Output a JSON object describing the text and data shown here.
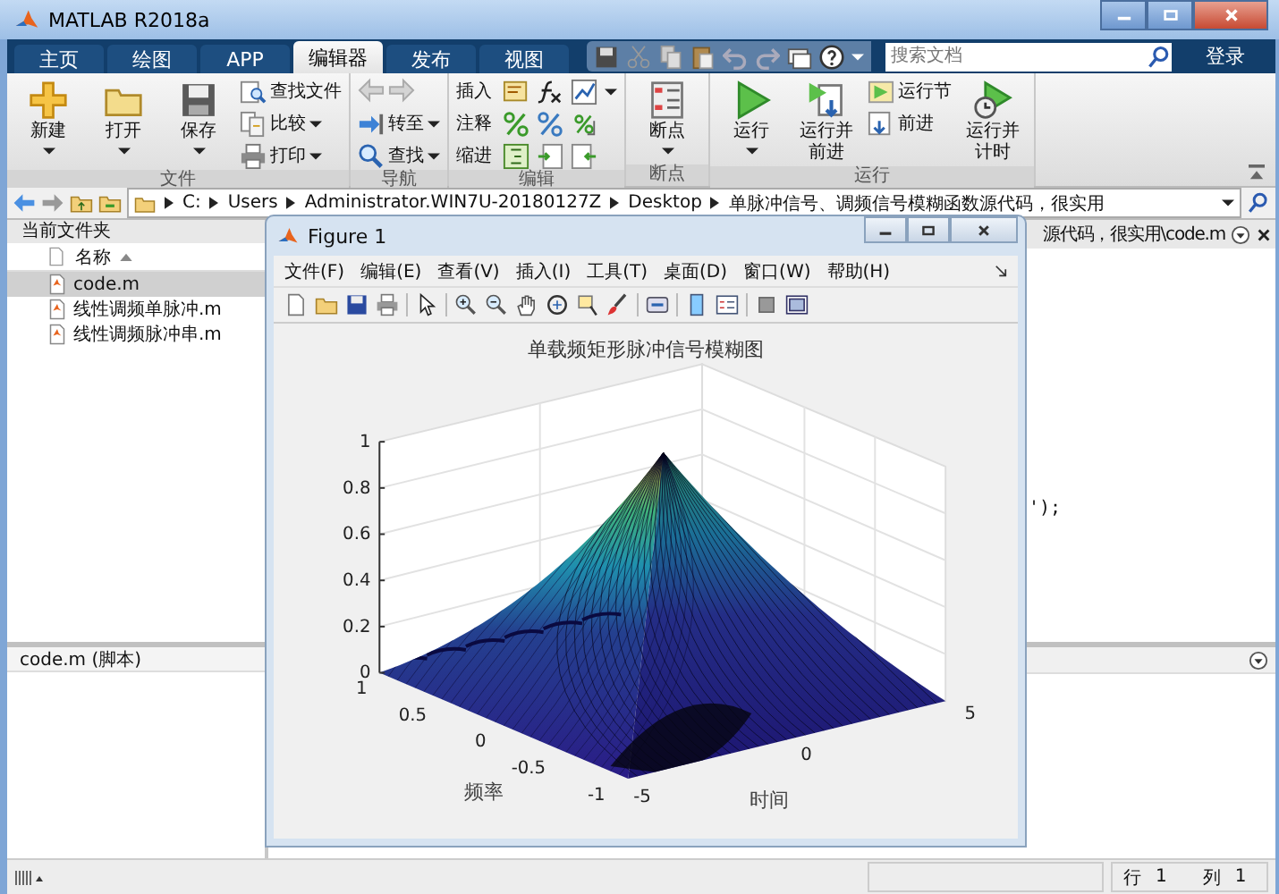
{
  "window": {
    "title": "MATLAB R2018a"
  },
  "tabs": [
    {
      "label": "主页",
      "selected": false
    },
    {
      "label": "绘图",
      "selected": false
    },
    {
      "label": "APP",
      "selected": false
    },
    {
      "label": "编辑器",
      "selected": true
    },
    {
      "label": "发布",
      "selected": false
    },
    {
      "label": "视图",
      "selected": false
    }
  ],
  "search": {
    "placeholder": "搜索文档"
  },
  "login_button": "登录",
  "ribbon": {
    "groups": [
      {
        "label": "文件",
        "columns": [
          [
            {
              "kind": "large",
              "label": "新建",
              "dropdown": true
            }
          ],
          [
            {
              "kind": "large",
              "label": "打开",
              "dropdown": true
            }
          ],
          [
            {
              "kind": "large",
              "label": "保存",
              "dropdown": true
            }
          ],
          [
            {
              "kind": "small",
              "label": "查找文件",
              "dropdown": false
            },
            {
              "kind": "small",
              "label": "比较",
              "dropdown": true
            },
            {
              "kind": "small",
              "label": "打印",
              "dropdown": true
            }
          ]
        ]
      },
      {
        "label": "导航",
        "columns": [
          [
            {
              "kind": "arrows",
              "disabled": true
            },
            {
              "kind": "small",
              "label": "转至",
              "dropdown": true
            },
            {
              "kind": "small",
              "label": "查找",
              "dropdown": true
            }
          ]
        ]
      },
      {
        "label": "编辑",
        "columns": [
          [
            {
              "kind": "edit",
              "label": "插入",
              "dropdown": true
            },
            {
              "kind": "edit",
              "label": "注释",
              "dropdown": false
            },
            {
              "kind": "edit",
              "label": "缩进",
              "dropdown": false
            }
          ]
        ]
      },
      {
        "label": "断点",
        "columns": [
          [
            {
              "kind": "large",
              "label": "断点",
              "dropdown": true
            }
          ]
        ]
      },
      {
        "label": "运行",
        "columns": [
          [
            {
              "kind": "large",
              "label": "运行",
              "dropdown": true
            }
          ],
          [
            {
              "kind": "large",
              "label": "运行并前进",
              "dropdown": false
            }
          ],
          [
            {
              "kind": "small",
              "label": "运行节",
              "dropdown": false
            },
            {
              "kind": "small",
              "label": "前进",
              "dropdown": false
            }
          ],
          [
            {
              "kind": "large",
              "label": "运行并计时",
              "dropdown": false
            }
          ]
        ]
      }
    ]
  },
  "address_bar": {
    "segments": [
      "C:",
      "Users",
      "Administrator.WIN7U-20180127Z",
      "Desktop",
      "单脉冲信号、调频信号模糊函数源代码，很实用"
    ]
  },
  "current_folder": {
    "title": "当前文件夹",
    "column": "名称",
    "files": [
      {
        "name": "code.m",
        "selected": true
      },
      {
        "name": "线性调频单脉冲.m",
        "selected": false
      },
      {
        "name": "线性调频脉冲串.m",
        "selected": false
      }
    ]
  },
  "details": {
    "text": "code.m  (脚本)"
  },
  "editor": {
    "tab_title": "源代码，很实用\\code.m",
    "code_fragment": "');"
  },
  "figure": {
    "title": "Figure 1",
    "menu": [
      "文件(F)",
      "编辑(E)",
      "查看(V)",
      "插入(I)",
      "工具(T)",
      "桌面(D)",
      "窗口(W)",
      "帮助(H)"
    ],
    "plot": {
      "title": "单载频矩形脉冲信号模糊图",
      "z_ticks": [
        "1",
        "0.8",
        "0.6",
        "0.4",
        "0.2",
        "0"
      ],
      "y_ticks": [
        "1",
        "0.5",
        "0",
        "-0.5",
        "-1"
      ],
      "ylabel": "频率",
      "x_ticks": [
        "-5",
        "0",
        "5"
      ],
      "xlabel": "时间"
    }
  },
  "status_bar": {
    "line_label": "行",
    "line_value": "1",
    "col_label": "列",
    "col_value": "1"
  }
}
